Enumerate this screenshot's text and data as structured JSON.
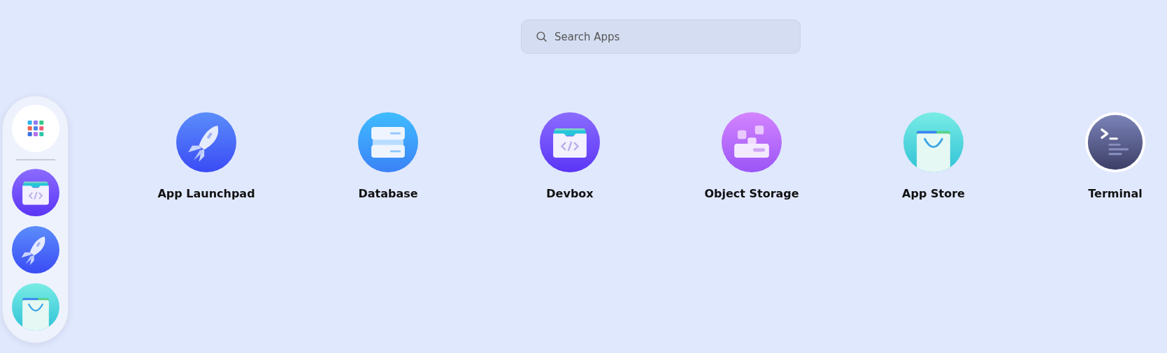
{
  "dock": {
    "items": [
      {
        "kind": "launcher"
      },
      {
        "kind": "devbox"
      },
      {
        "kind": "launchpad"
      },
      {
        "kind": "store"
      }
    ]
  },
  "search": {
    "placeholder": "Search Apps"
  },
  "apps": [
    {
      "kind": "launchpad",
      "label": "App Launchpad"
    },
    {
      "kind": "database",
      "label": "Database"
    },
    {
      "kind": "devbox",
      "label": "Devbox"
    },
    {
      "kind": "storage",
      "label": "Object Storage"
    },
    {
      "kind": "store",
      "label": "App Store"
    },
    {
      "kind": "terminal",
      "label": "Terminal"
    }
  ]
}
